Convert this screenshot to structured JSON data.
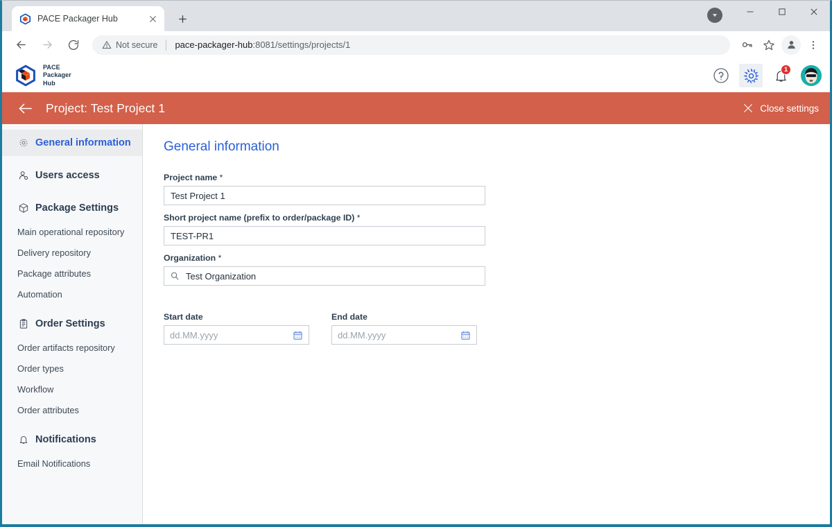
{
  "browser": {
    "tab": {
      "title": "PACE Packager Hub",
      "favicon_icon": "cube-favicon",
      "close_icon": "close-icon"
    },
    "new_tab_label": "+",
    "window_controls": {
      "download_icon": "download-chip-icon",
      "minimize_label": "—",
      "maximize_label": "□",
      "close_label": "✕"
    },
    "toolbar": {
      "back_icon": "back-arrow-icon",
      "forward_icon": "forward-arrow-icon",
      "reload_icon": "reload-icon",
      "security_label": "Not secure",
      "security_icon": "warning-triangle-icon",
      "url_host": "pace-packager-hub",
      "url_path": ":8081/settings/projects/1",
      "password_icon": "key-icon",
      "bookmark_icon": "star-icon",
      "profile_icon": "profile-avatar-icon",
      "menu_icon": "three-dot-menu-icon"
    }
  },
  "app_header": {
    "brand_line1": "PACE",
    "brand_line2": "Packager",
    "brand_line3": "Hub",
    "help_icon": "question-mark-icon",
    "settings_icon": "gear-icon",
    "notifications_icon": "bell-icon",
    "notifications_count": "1",
    "avatar_icon": "user-avatar"
  },
  "settings_bar": {
    "back_icon": "back-arrow-icon",
    "title": "Project: Test Project 1",
    "close_label": "Close settings",
    "close_icon": "close-x-icon",
    "background_color": "#d2604a"
  },
  "sidebar": {
    "groups": [
      {
        "label": "General information",
        "icon": "gear-icon",
        "selected": true,
        "items": []
      },
      {
        "label": "Users access",
        "icon": "user-access-icon",
        "selected": false,
        "items": []
      },
      {
        "label": "Package Settings",
        "icon": "cube-icon",
        "selected": false,
        "items": [
          "Main operational repository",
          "Delivery repository",
          "Package attributes",
          "Automation"
        ]
      },
      {
        "label": "Order Settings",
        "icon": "clipboard-icon",
        "selected": false,
        "items": [
          "Order artifacts repository",
          "Order types",
          "Workflow",
          "Order attributes"
        ]
      },
      {
        "label": "Notifications",
        "icon": "bell-icon",
        "selected": false,
        "items": [
          "Email Notifications"
        ]
      }
    ]
  },
  "main": {
    "heading": "General information",
    "fields": {
      "project_name": {
        "label": "Project name",
        "required_mark": " *",
        "value": "Test Project 1"
      },
      "short_project_name": {
        "label": "Short project name (prefix to order/package ID)",
        "required_mark": " *",
        "value": "TEST-PR1"
      },
      "organization": {
        "label": "Organization",
        "required_mark": " *",
        "value": "Test Organization",
        "lead_icon": "search-icon"
      },
      "start_date": {
        "label": "Start date",
        "placeholder": "dd.MM.yyyy",
        "value": "",
        "trail_icon": "calendar-icon"
      },
      "end_date": {
        "label": "End date",
        "placeholder": "dd.MM.yyyy",
        "value": "",
        "trail_icon": "calendar-icon"
      }
    }
  },
  "colors": {
    "accent_blue": "#2b5fd9",
    "settings_orange": "#d2604a",
    "window_border": "#1b7ba0",
    "badge_red": "#e03030"
  }
}
